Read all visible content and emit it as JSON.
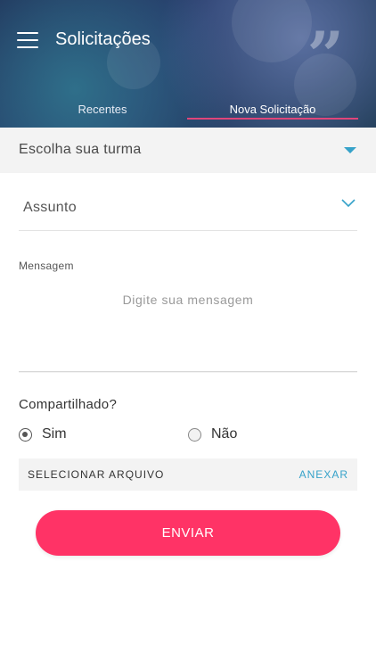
{
  "header": {
    "title": "Solicitações",
    "tabs": [
      {
        "label": "Recentes",
        "active": false
      },
      {
        "label": "Nova Solicitação",
        "active": true
      }
    ]
  },
  "form": {
    "class_select": {
      "value": "Escolha sua turma"
    },
    "subject": {
      "value": "Assunto"
    },
    "message": {
      "label": "Mensagem",
      "placeholder": "Digite sua mensagem"
    },
    "shared": {
      "question": "Compartilhado?",
      "options": [
        {
          "label": "Sim",
          "selected": true
        },
        {
          "label": "Não",
          "selected": false
        }
      ]
    },
    "file": {
      "label": "SELECIONAR ARQUIVO",
      "action": "ANEXAR"
    },
    "submit_label": "ENVIAR"
  },
  "colors": {
    "accent": "#ff3366",
    "link": "#36a2c9",
    "tab_indicator": "#e0457a",
    "header_bg": "#283e6e"
  },
  "icons": {
    "menu": "hamburger-menu-icon",
    "class_dropdown": "caret-down-filled-icon",
    "subject_dropdown": "chevron-down-icon"
  }
}
